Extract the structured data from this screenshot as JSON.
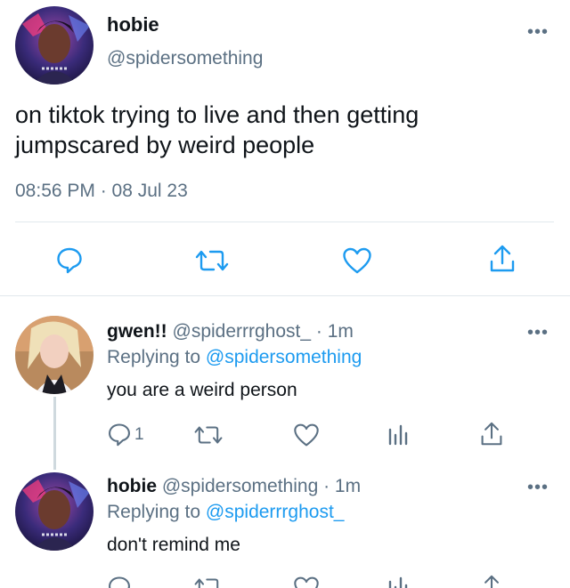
{
  "main_tweet": {
    "name": "hobie",
    "handle": "@spidersomething",
    "text_line1": "on tiktok trying to live and then getting",
    "text_line2": "jumpscared by weird people",
    "timestamp": "08:56 PM · 08 Jul 23",
    "more_label": "•••"
  },
  "replies": [
    {
      "name": "gwen!!",
      "handle": "@spiderrrghost_",
      "time": "· 1m",
      "replying_prefix": "Replying to",
      "replying_to": "@spidersomething",
      "text": "you are a weird person",
      "reply_count": "1",
      "more_label": "•••"
    },
    {
      "name": "hobie",
      "handle": "@spidersomething",
      "time": "· 1m",
      "replying_prefix": "Replying to",
      "replying_to": "@spiderrrghost_",
      "text": "don't remind me",
      "more_label": "•••"
    }
  ],
  "colors": {
    "text": "#0f1419",
    "secondary": "#5b7083",
    "link": "#1d9bf0",
    "divider": "#e1e8ed"
  },
  "icons": [
    "reply-icon",
    "retweet-icon",
    "like-icon",
    "share-icon",
    "analytics-icon",
    "more-icon"
  ]
}
